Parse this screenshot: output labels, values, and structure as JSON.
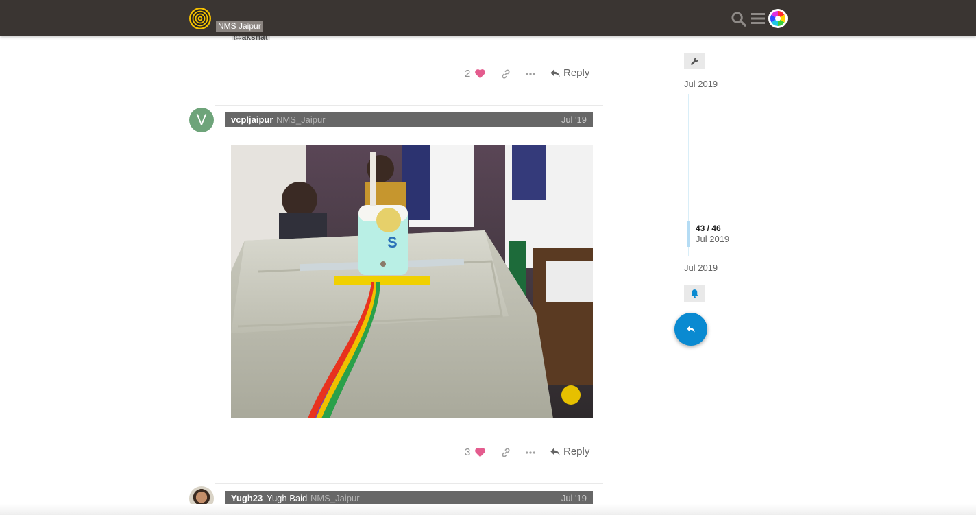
{
  "header": {
    "site_name": "NMS Jaipur",
    "icons": [
      "logo-icon",
      "search-icon",
      "hamburger-menu-icon",
      "user-avatar-icon"
    ]
  },
  "previous_post": {
    "mention": "@akshat",
    "likes": "2",
    "reply_label": "Reply"
  },
  "post": {
    "username": "vcpljaipur",
    "group": "NMS_Jaipur",
    "date": "Jul '19",
    "avatar_letter": "V",
    "likes": "3",
    "reply_label": "Reply"
  },
  "next_post": {
    "username": "Yugh23",
    "full_name": "Yugh Baid",
    "group": "NMS_Jaipur",
    "date": "Jul '19"
  },
  "timeline": {
    "start_date": "Jul 2019",
    "position": "43 / 46",
    "position_date": "Jul 2019",
    "end_date": "Jul 2019"
  },
  "colors": {
    "header_bg": "#3a3532",
    "accent": "#0a8ad1",
    "like": "#e45c8e",
    "avatar_v": "#6ea47a"
  }
}
